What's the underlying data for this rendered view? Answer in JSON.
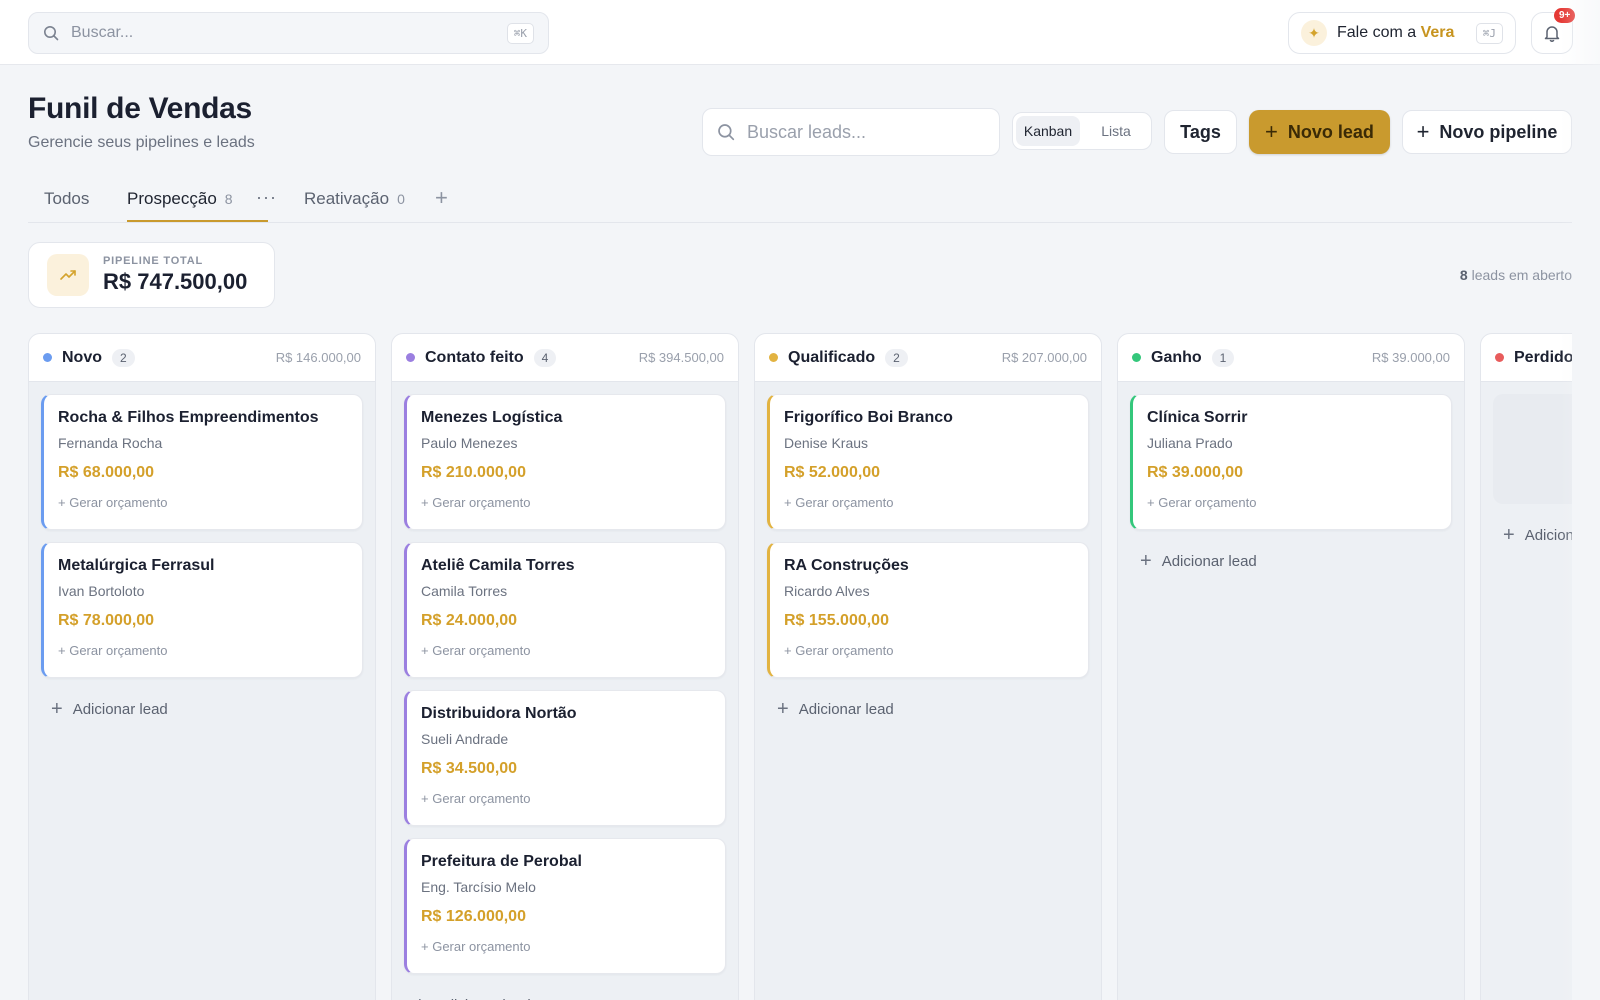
{
  "topbar": {
    "search_placeholder": "Buscar...",
    "search_shortcut": "⌘K",
    "vera_prefix": "Fale com a",
    "vera_name": "Vera",
    "vera_shortcut": "⌘J",
    "notifications_badge": "9+"
  },
  "header": {
    "title": "Funil de Vendas",
    "subtitle": "Gerencie seus pipelines e leads",
    "leads_search_placeholder": "Buscar leads...",
    "view_options": [
      "Kanban",
      "Lista"
    ],
    "active_view": "Kanban",
    "tags_label": "Tags",
    "new_lead_label": "Novo lead",
    "new_pipeline_label": "Novo pipeline"
  },
  "tabs": [
    {
      "label": "Todos",
      "count": ""
    },
    {
      "label": "Prospecção",
      "count": "8"
    },
    {
      "label": "Reativação",
      "count": "0"
    }
  ],
  "active_tab": "Prospecção",
  "summary": {
    "label": "PIPELINE TOTAL",
    "value": "R$ 747.500,00",
    "open_count": "8",
    "open_label": "leads em aberto"
  },
  "colors": {
    "accent": "#c99a2e",
    "value_text": "#d4a02a",
    "novo": "#6b9cf0",
    "contato": "#9b7fe0",
    "qualificado": "#e2b341",
    "ganho": "#34c77b",
    "perdido": "#e85c5c"
  },
  "board": {
    "quote_label": "+ Gerar orçamento",
    "add_lead_label": "Adicionar lead",
    "columns": [
      {
        "title": "Novo",
        "count": "2",
        "total": "R$ 146.000,00",
        "color": "#6b9cf0",
        "cards": [
          {
            "company": "Rocha & Filhos Empreendimentos",
            "contact": "Fernanda Rocha",
            "value": "R$ 68.000,00"
          },
          {
            "company": "Metalúrgica Ferrasul",
            "contact": "Ivan Bortoloto",
            "value": "R$ 78.000,00"
          }
        ]
      },
      {
        "title": "Contato feito",
        "count": "4",
        "total": "R$ 394.500,00",
        "color": "#9b7fe0",
        "cards": [
          {
            "company": "Menezes Logística",
            "contact": "Paulo Menezes",
            "value": "R$ 210.000,00"
          },
          {
            "company": "Ateliê Camila Torres",
            "contact": "Camila Torres",
            "value": "R$ 24.000,00"
          },
          {
            "company": "Distribuidora Nortão",
            "contact": "Sueli Andrade",
            "value": "R$ 34.500,00"
          },
          {
            "company": "Prefeitura de Perobal",
            "contact": "Eng. Tarcísio Melo",
            "value": "R$ 126.000,00"
          }
        ]
      },
      {
        "title": "Qualificado",
        "count": "2",
        "total": "R$ 207.000,00",
        "color": "#e2b341",
        "cards": [
          {
            "company": "Frigorífico Boi Branco",
            "contact": "Denise Kraus",
            "value": "R$ 52.000,00"
          },
          {
            "company": "RA Construções",
            "contact": "Ricardo Alves",
            "value": "R$ 155.000,00"
          }
        ]
      },
      {
        "title": "Ganho",
        "count": "1",
        "total": "R$ 39.000,00",
        "color": "#34c77b",
        "cards": [
          {
            "company": "Clínica Sorrir",
            "contact": "Juliana Prado",
            "value": "R$ 39.000,00"
          }
        ]
      },
      {
        "title": "Perdido",
        "count": "",
        "total": "",
        "color": "#e85c5c",
        "cards": []
      }
    ]
  }
}
